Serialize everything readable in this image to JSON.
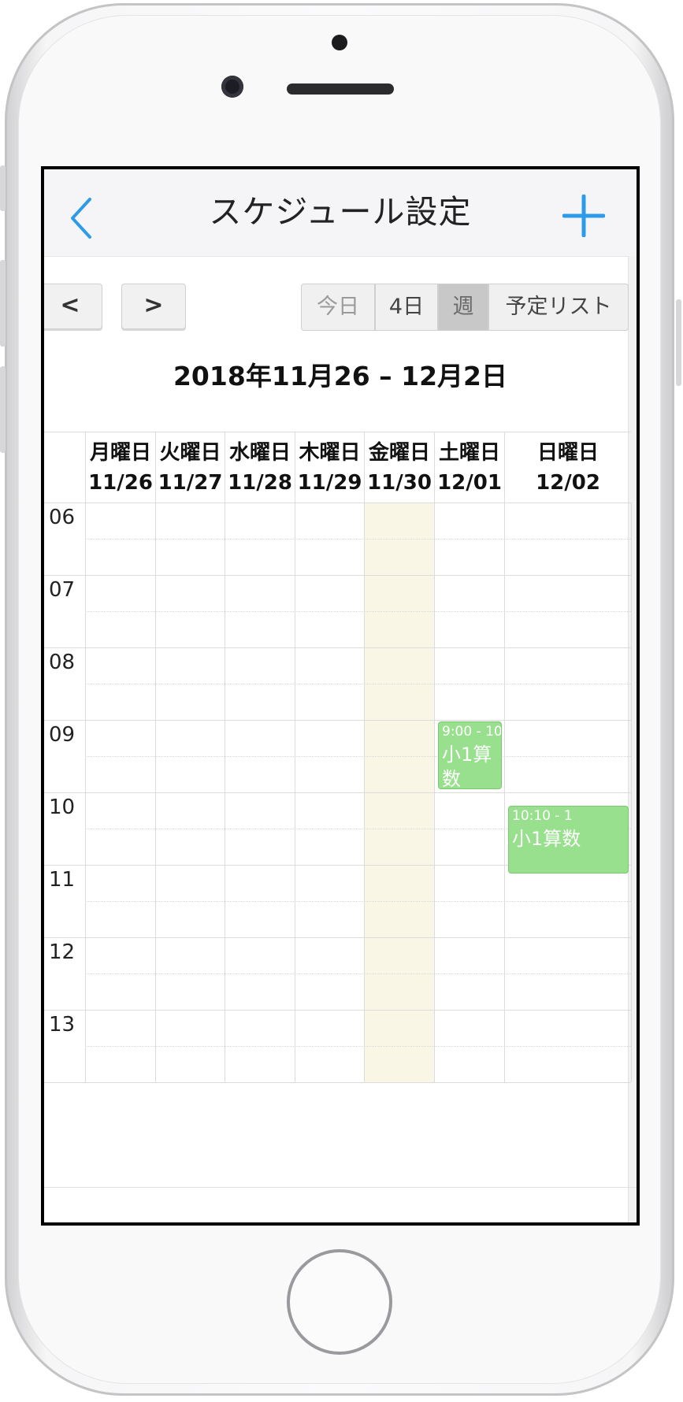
{
  "header": {
    "title": "スケジュール設定"
  },
  "toolbar": {
    "prev_label": "<",
    "next_label": ">",
    "today_label": "今日",
    "four_day_label": "4日",
    "week_label": "週",
    "list_label": "予定リスト",
    "active_view": "週"
  },
  "range_label": "2018年11月26 – 12月2日",
  "days": [
    {
      "name": "月曜日",
      "date": "11/26"
    },
    {
      "name": "火曜日",
      "date": "11/27"
    },
    {
      "name": "水曜日",
      "date": "11/28"
    },
    {
      "name": "木曜日",
      "date": "11/29"
    },
    {
      "name": "金曜日",
      "date": "11/30"
    },
    {
      "name": "土曜日",
      "date": "12/01"
    },
    {
      "name": "日曜日",
      "date": "12/02"
    }
  ],
  "hours": [
    "06",
    "07",
    "08",
    "09",
    "10",
    "11",
    "12",
    "13"
  ],
  "today_index": 4,
  "events": [
    {
      "day": 5,
      "time": "9:00 - 10:",
      "title": "小1算数",
      "start_hour": 9.0,
      "end_hour": 10.0
    },
    {
      "day": 6,
      "time": "10:10 - 1",
      "title": "小1算数",
      "start_hour": 10.1667,
      "end_hour": 11.1667
    }
  ],
  "colors": {
    "accent": "#2e9be8",
    "event_green": "#98e08d",
    "today_bg": "#faf6e5",
    "header_bg": "#f5f5f7"
  },
  "icons": {
    "back": "chevron-left-icon",
    "add": "plus-icon"
  }
}
